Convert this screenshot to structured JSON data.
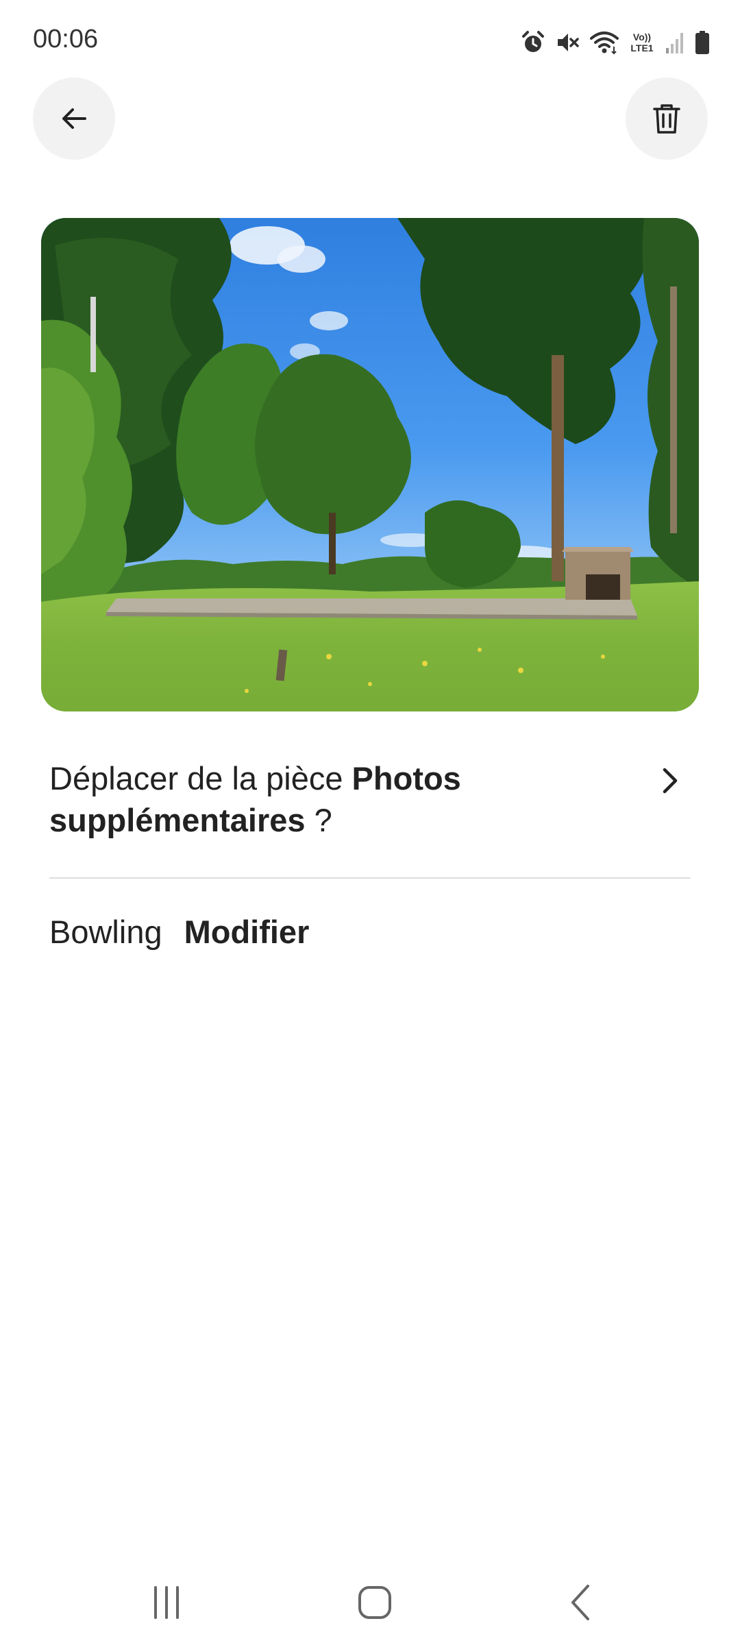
{
  "status_bar": {
    "time": "00:06",
    "icons": [
      "alarm-icon",
      "mute-icon",
      "wifi-icon",
      "volte-lte-icon",
      "signal-icon",
      "battery-icon"
    ],
    "lte_label_top": "Vo))",
    "lte_label_bottom": "LTE1"
  },
  "header": {
    "back_icon": "arrow-left-icon",
    "delete_icon": "trash-icon"
  },
  "photo": {
    "subject": "garden-with-trees"
  },
  "move_prompt": {
    "prefix": "Déplacer de la pièce ",
    "room": "Photos supplémentaires",
    "suffix": " ?"
  },
  "room": {
    "name": "Bowling",
    "edit_label": "Modifier"
  },
  "nav_bar": {
    "icons": [
      "recents-icon",
      "home-icon",
      "back-icon"
    ]
  },
  "colors": {
    "background": "#ffffff",
    "text": "#222222",
    "button_bg": "#f2f2f2",
    "divider": "#dddddd"
  }
}
